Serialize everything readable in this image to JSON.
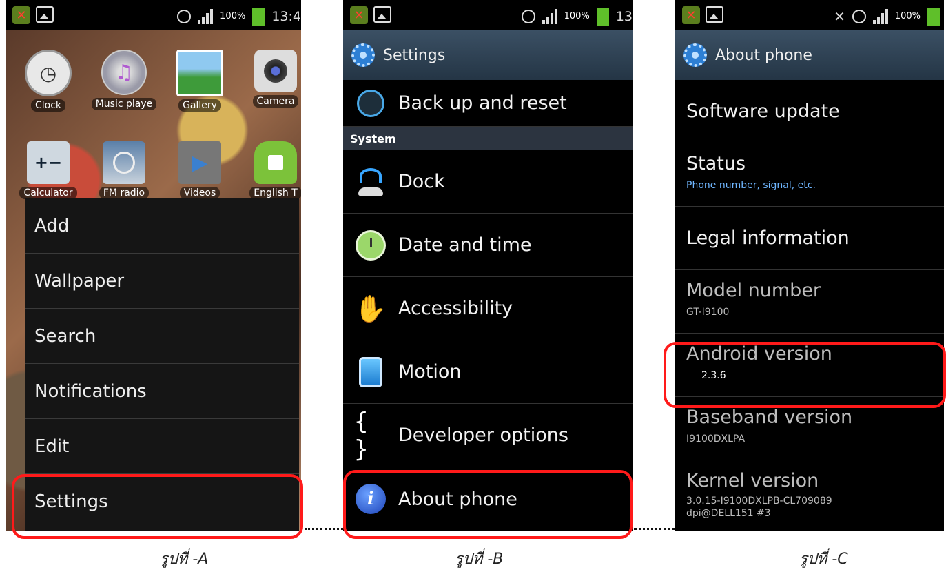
{
  "screen_a": {
    "status_time": "13:4",
    "battery": "100%",
    "apps_row1": [
      {
        "label": "Clock",
        "icon": "clock-icon",
        "glyph": "🕒"
      },
      {
        "label": "Music playe",
        "icon": "music-player-icon",
        "glyph": "♫"
      },
      {
        "label": "Gallery",
        "icon": "gallery-icon",
        "glyph": "🏞"
      },
      {
        "label": "Camera",
        "icon": "camera-icon",
        "glyph": "📷"
      }
    ],
    "apps_row2": [
      {
        "label": "Calculator",
        "icon": "calculator-icon",
        "glyph": "±"
      },
      {
        "label": "FM radio",
        "icon": "fm-radio-icon",
        "glyph": "📻"
      },
      {
        "label": "Videos",
        "icon": "videos-icon",
        "glyph": "▶"
      },
      {
        "label": "English T",
        "icon": "android-app-icon",
        "glyph": "🤖"
      }
    ],
    "menu": [
      "Add",
      "Wallpaper",
      "Search",
      "Notifications",
      "Edit",
      "Settings"
    ],
    "caption": "รูปที่ -A"
  },
  "screen_b": {
    "status_time": "13",
    "battery": "100%",
    "title": "Settings",
    "backup": "Back up and reset",
    "section": "System",
    "items": [
      "Dock",
      "Date and time",
      "Accessibility",
      "Motion",
      "Developer options",
      "About phone"
    ],
    "caption": "รูปที่ -B"
  },
  "screen_c": {
    "battery": "100%",
    "title": "About phone",
    "software_update": "Software update",
    "status_title": "Status",
    "status_sub": "Phone number, signal, etc.",
    "legal": "Legal information",
    "model_title": "Model number",
    "model_value": "GT-I9100",
    "android_title": "Android version",
    "android_value": "2.3.6",
    "baseband_title": "Baseband version",
    "baseband_value": "I9100DXLPA",
    "kernel_title": "Kernel version",
    "kernel_value1": "3.0.15-I9100DXLPB-CL709089",
    "kernel_value2": "dpi@DELL151 #3",
    "caption": "รูปที่ -C"
  },
  "colors": {
    "highlight": "#ff1a1a",
    "titlebar": "#2f4356",
    "status_link": "#6fb6ff"
  }
}
